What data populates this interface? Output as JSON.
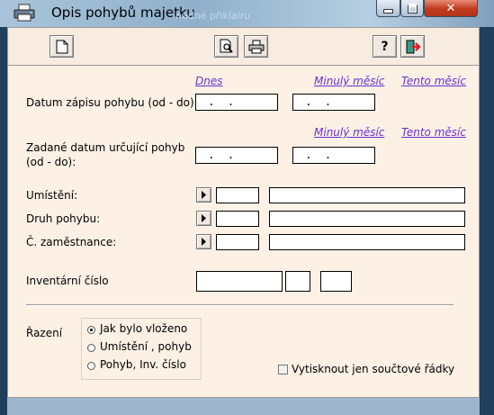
{
  "window": {
    "title": "Opis pohybů majetku",
    "background_title": "nadné přiklairu"
  },
  "toolbar": {
    "buttons": [
      "new-document",
      "print-preview",
      "print",
      "help",
      "exit"
    ]
  },
  "dates": {
    "link_today": "Dnes",
    "link_last_month": "Minulý měsíc",
    "link_this_month": "Tento měsíc",
    "entry_date_label": "Datum zápisu pohybu (od - do):",
    "entry_date_from": " .  .",
    "entry_date_to": " .  .",
    "link_last_month_2": "Minulý měsíc",
    "link_this_month_2": "Tento měsíc",
    "move_date_label_line1": "Zadané datum určující pohyb",
    "move_date_label_line2": "(od - do):",
    "move_date_from": " .  .",
    "move_date_to": " .  ."
  },
  "lookups": {
    "location_label": "Umístění:",
    "movement_type_label": "Druh pohybu:",
    "employee_label": "Č. zaměstnance:"
  },
  "inventory": {
    "label": "Inventární číslo"
  },
  "sorting": {
    "label": "Řazení",
    "options": [
      "Jak bylo vloženo",
      "Umístění , pohyb",
      "Pohyb, Inv. číslo"
    ],
    "selected_index": 0
  },
  "totals_only": {
    "label": "Vytisknout jen součtové řádky",
    "checked": false
  }
}
